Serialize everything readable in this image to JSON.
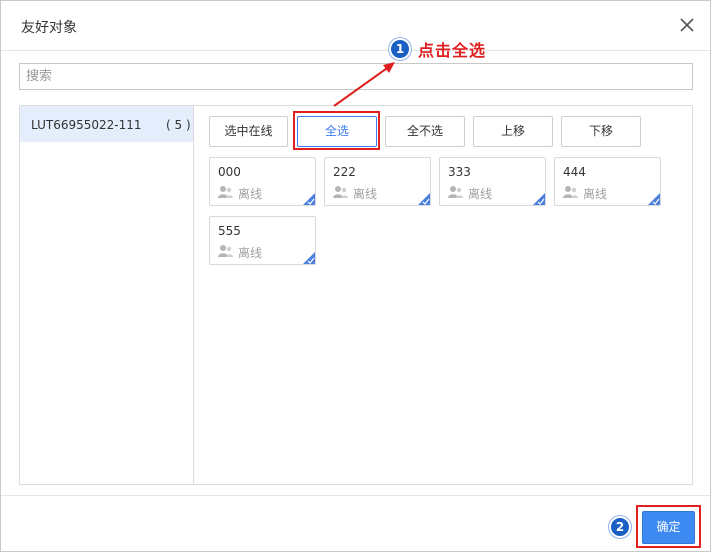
{
  "dialog": {
    "title": "友好对象",
    "close_icon": "close-icon"
  },
  "search": {
    "placeholder": "搜索",
    "value": ""
  },
  "group_list": [
    {
      "name": "LUT66955022-111",
      "count": "( 5 )"
    }
  ],
  "toolbar": {
    "select_online": "选中在线",
    "select_all": "全选",
    "select_none": "全不选",
    "move_up": "上移",
    "move_down": "下移"
  },
  "contacts": [
    {
      "name": "000",
      "status": "离线"
    },
    {
      "name": "222",
      "status": "离线"
    },
    {
      "name": "333",
      "status": "离线"
    },
    {
      "name": "444",
      "status": "离线"
    },
    {
      "name": "555",
      "status": "离线"
    }
  ],
  "footer": {
    "confirm": "确定"
  },
  "annotations": {
    "step1_number": "1",
    "step1_text": "点击全选",
    "step2_number": "2"
  },
  "colors": {
    "accent": "#3d7cf2",
    "highlight": "#e02020",
    "selected_group_bg": "#e3edfb",
    "badge": "#1a5fc2"
  }
}
